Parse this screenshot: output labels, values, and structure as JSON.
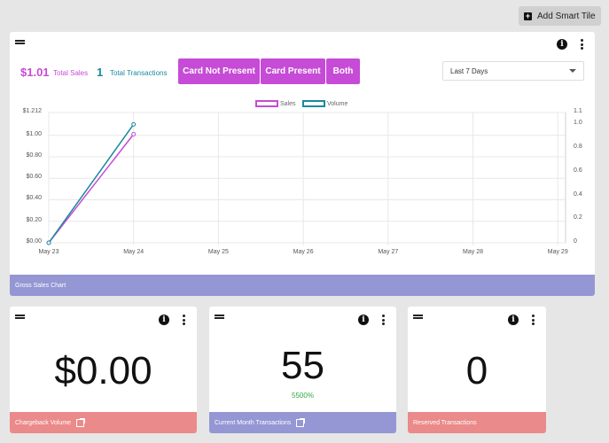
{
  "toolbar": {
    "add_tile_label": "Add Smart Tile"
  },
  "main_card": {
    "total_sales_value": "$1.01",
    "total_sales_label": "Total Sales",
    "total_transactions_value": "1",
    "total_transactions_label": "Total Transactions",
    "filters": [
      "Card Not Present",
      "Card Present",
      "Both"
    ],
    "date_range": "Last 7 Days",
    "footer_label": "Gross Sales Chart"
  },
  "chart_data": {
    "type": "line",
    "categories": [
      "May 23",
      "May 24",
      "May 25",
      "May 26",
      "May 27",
      "May 28",
      "May 29"
    ],
    "series": [
      {
        "name": "Sales",
        "color": "#c64bd6",
        "axis": "left",
        "values": [
          0.0,
          1.01,
          null,
          null,
          null,
          null,
          null
        ]
      },
      {
        "name": "Volume",
        "color": "#1a8a9e",
        "axis": "right",
        "values": [
          0,
          1,
          null,
          null,
          null,
          null,
          null
        ]
      }
    ],
    "y_left_ticks": [
      "$0.00",
      "$0.20",
      "$0.40",
      "$0.60",
      "$0.80",
      "$1.00",
      "$1.212"
    ],
    "y_left_values": [
      0,
      0.2,
      0.4,
      0.6,
      0.8,
      1.0,
      1.212
    ],
    "y_right_ticks": [
      "0",
      "0.2",
      "0.4",
      "0.6",
      "0.8",
      "1.0",
      "1.1"
    ],
    "y_right_values": [
      0,
      0.2,
      0.4,
      0.6,
      0.8,
      1.0,
      1.1
    ],
    "ylim_left": [
      0,
      1.212
    ],
    "ylim_right": [
      0,
      1.1
    ],
    "grid": true,
    "legend": "top-center"
  },
  "tiles": [
    {
      "value": "$0.00",
      "badge": "",
      "footer": "Chargeback Volume",
      "color": "#eb8a8a",
      "external": true
    },
    {
      "value": "55",
      "badge": "5500%",
      "footer": "Current Month Transactions",
      "color": "#9596d4",
      "external": true
    },
    {
      "value": "0",
      "badge": "",
      "footer": "Reserved Transactions",
      "color": "#eb8a8a",
      "external": false
    }
  ],
  "colors": {
    "accent": "#c64bd6",
    "teal": "#1a8a9e",
    "footer_blue": "#9596d4",
    "footer_red": "#eb8a8a"
  }
}
